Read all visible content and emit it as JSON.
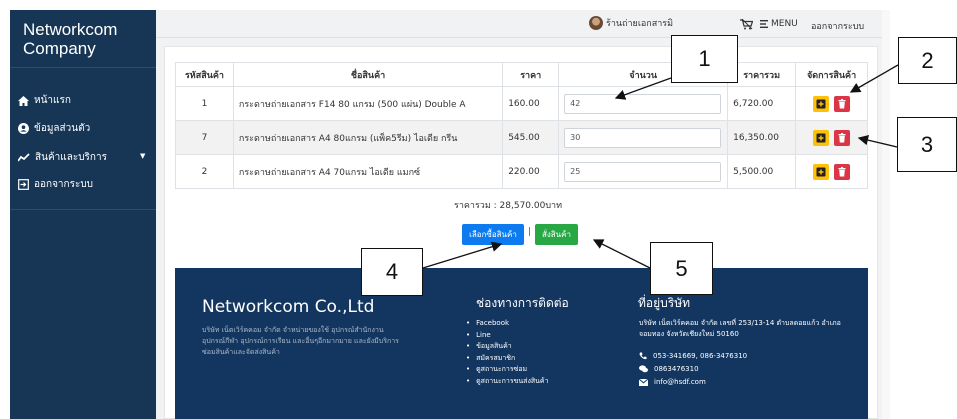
{
  "sidebar": {
    "brand_line1": "Networkcom",
    "brand_line2": "Company",
    "items": [
      {
        "label": "หน้าแรก",
        "icon": "home-icon"
      },
      {
        "label": "ข้อมูลส่วนตัว",
        "icon": "user-circle-icon"
      },
      {
        "label": "สินค้าและบริการ",
        "icon": "chart-line-icon"
      },
      {
        "label": "ออกจากระบบ",
        "icon": "sign-out-icon"
      }
    ]
  },
  "topbar": {
    "shop_name": "ร้านถ่ายเอกสารมิ",
    "menu_label": "MENU",
    "logout_label": "ออกจากระบบ"
  },
  "table": {
    "headers": [
      "รหัสสินค้า",
      "ชื่อสินค้า",
      "ราคา",
      "จำนวน",
      "ราคารวม",
      "จัดการสินค้า"
    ],
    "rows": [
      {
        "id": "1",
        "name": "กระดาษถ่ายเอกสาร F14 80 แกรม (500 แผ่น) Double A",
        "price": "160.00",
        "qty": "42",
        "total": "6,720.00"
      },
      {
        "id": "7",
        "name": "กระดาษถ่ายเอกสาร A4 80แกรม (แพ็ค5รีม) ไอเดีย กรีน",
        "price": "545.00",
        "qty": "30",
        "total": "16,350.00"
      },
      {
        "id": "2",
        "name": "กระดาษถ่ายเอกสาร A4 70แกรม ไอเดีย แมกซ์",
        "price": "220.00",
        "qty": "25",
        "total": "5,500.00"
      }
    ]
  },
  "summary": {
    "grand_total": "ราคารวม : 28,570.00บาท"
  },
  "actions": {
    "continue_label": "เลือกซื้อสินค้า",
    "separator": "|",
    "order_label": "สั่งสินค้า"
  },
  "footer": {
    "company_title": "Networkcom Co.,Ltd",
    "company_desc": "บริษัท เน็ตเวิร์คคอม จำกัด จำหน่ายของใช้ อุปกรณ์สำนักงาน อุปกรณ์กีฬา อุปกรณ์การเรียน และอื่นๆอีกมากมาย และยังมีบริการซ่อมสินค้าและจัดส่งสินค้า",
    "contact_title": "ช่องทางการติดต่อ",
    "links": [
      "Facebook",
      "Line",
      "ข้อมูลสินค้า",
      "สมัครสมาชิก",
      "ดูสถานะการซ่อม",
      "ดูสถานะการขนส่งสินค้า"
    ],
    "address_title": "ที่อยู่บริษัท",
    "address": "บริษัท เน็ตเวิร์คคอม จำกัด เลขที่ 253/13-14 ตำบลดอยแก้ว อำเภอจอมทอง จังหวัดเชียงใหม่ 50160",
    "phone": "053-341669, 086-3476310",
    "line_id": "0863476310",
    "email": "info@hsdf.com"
  },
  "callouts": [
    "1",
    "2",
    "3",
    "4",
    "5"
  ],
  "colors": {
    "sidebar": "#173655",
    "footer": "#133660",
    "primary": "#0d7bef",
    "success": "#28a745",
    "warning": "#ffc107",
    "danger": "#dc3545"
  }
}
